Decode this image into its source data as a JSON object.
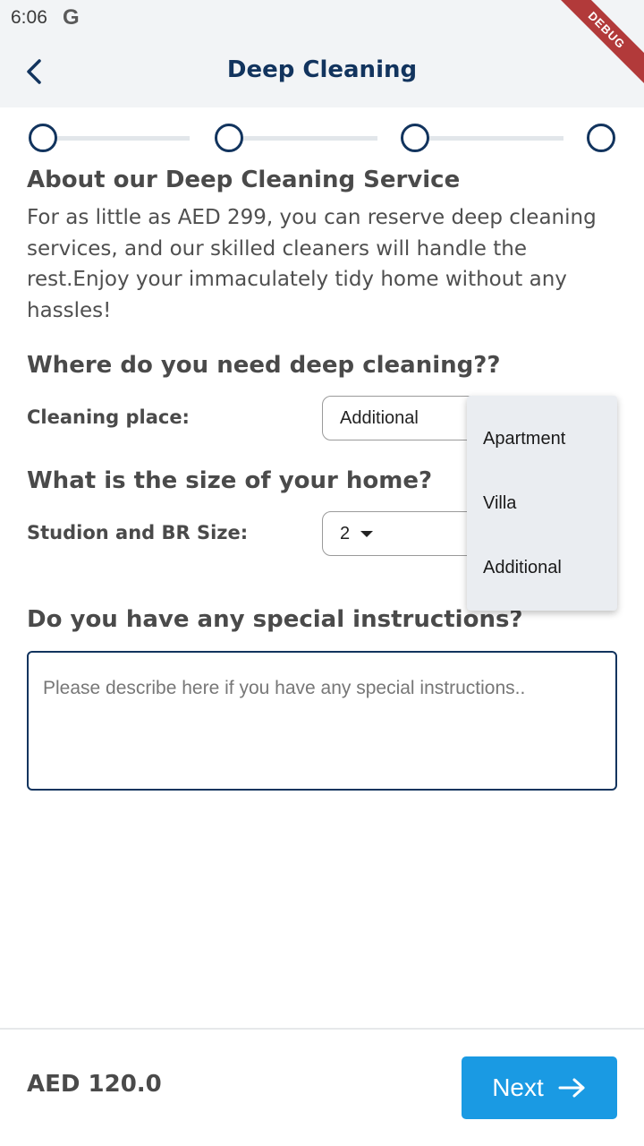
{
  "status_bar": {
    "time": "6:06",
    "g_logo": "G"
  },
  "debug_banner": "DEBUG",
  "app_bar": {
    "title": "Deep Cleaning",
    "back_icon": "chevron-left-icon"
  },
  "stepper": {
    "total_steps": 4,
    "current_step": 1
  },
  "about": {
    "title": "About our Deep Cleaning Service",
    "description": "For as little as AED 299, you can reserve deep cleaning services, and our skilled cleaners will handle the rest.Enjoy your immaculately tidy home without any hassles!"
  },
  "location_section": {
    "title": "Where do you need deep cleaning??",
    "label": "Cleaning place:",
    "selected": "Additional",
    "options": [
      "Apartment",
      "Villa",
      "Additional"
    ]
  },
  "size_section": {
    "title": "What is the size of your home?",
    "label": "Studion and BR Size:",
    "selected": "2"
  },
  "instructions_section": {
    "title": "Do you have any special instructions?",
    "placeholder": "Please describe here if you have any special instructions.."
  },
  "footer": {
    "price": "AED 120.0",
    "next_label": "Next",
    "next_icon": "arrow-right-icon"
  },
  "colors": {
    "primary_dark": "#12345e",
    "accent": "#1a9ae3",
    "debug": "#b23a3a",
    "appbar_bg": "#f2f4f6"
  }
}
